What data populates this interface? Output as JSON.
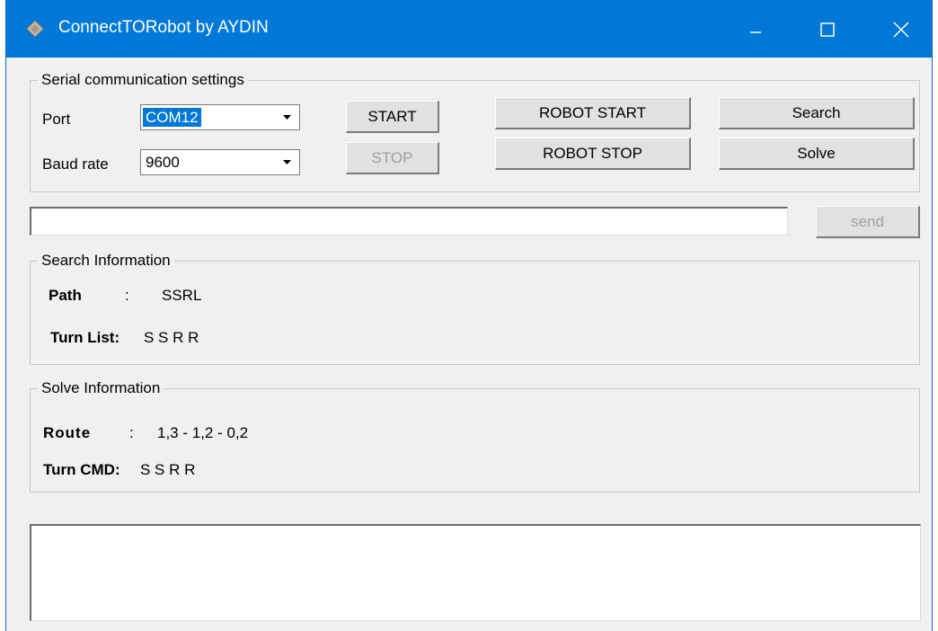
{
  "window": {
    "title": "ConnectTORobot by AYDIN"
  },
  "serial": {
    "legend": "Serial communication settings",
    "port_label": "Port",
    "port_value": "COM12",
    "baud_label": "Baud rate",
    "baud_value": "9600",
    "start_label": "START",
    "stop_label": "STOP",
    "robot_start_label": "ROBOT START",
    "robot_stop_label": "ROBOT STOP",
    "search_label": "Search",
    "solve_label": "Solve"
  },
  "send_row": {
    "input_value": "",
    "send_label": "send"
  },
  "search_info": {
    "legend": "Search Information",
    "path_label": "Path",
    "path_colon": ":",
    "path_value": "SSRL",
    "turnlist_label": "Turn List:",
    "turnlist_value": "S S R R"
  },
  "solve_info": {
    "legend": "Solve Information",
    "route_label": "Route",
    "route_colon": ":",
    "route_value": "1,3 - 1,2 - 0,2",
    "turncmd_label": "Turn CMD:",
    "turncmd_value": "S S R R"
  },
  "log": {
    "value": ""
  },
  "colors": {
    "titlebar": "#0078d7",
    "selection": "#0078d7",
    "window_bg": "#f0f0f0"
  },
  "icons": {
    "app": "diamond-app-icon",
    "minimize": "minimize-icon",
    "maximize": "maximize-icon",
    "close": "close-icon",
    "dropdown": "chevron-down-icon"
  }
}
